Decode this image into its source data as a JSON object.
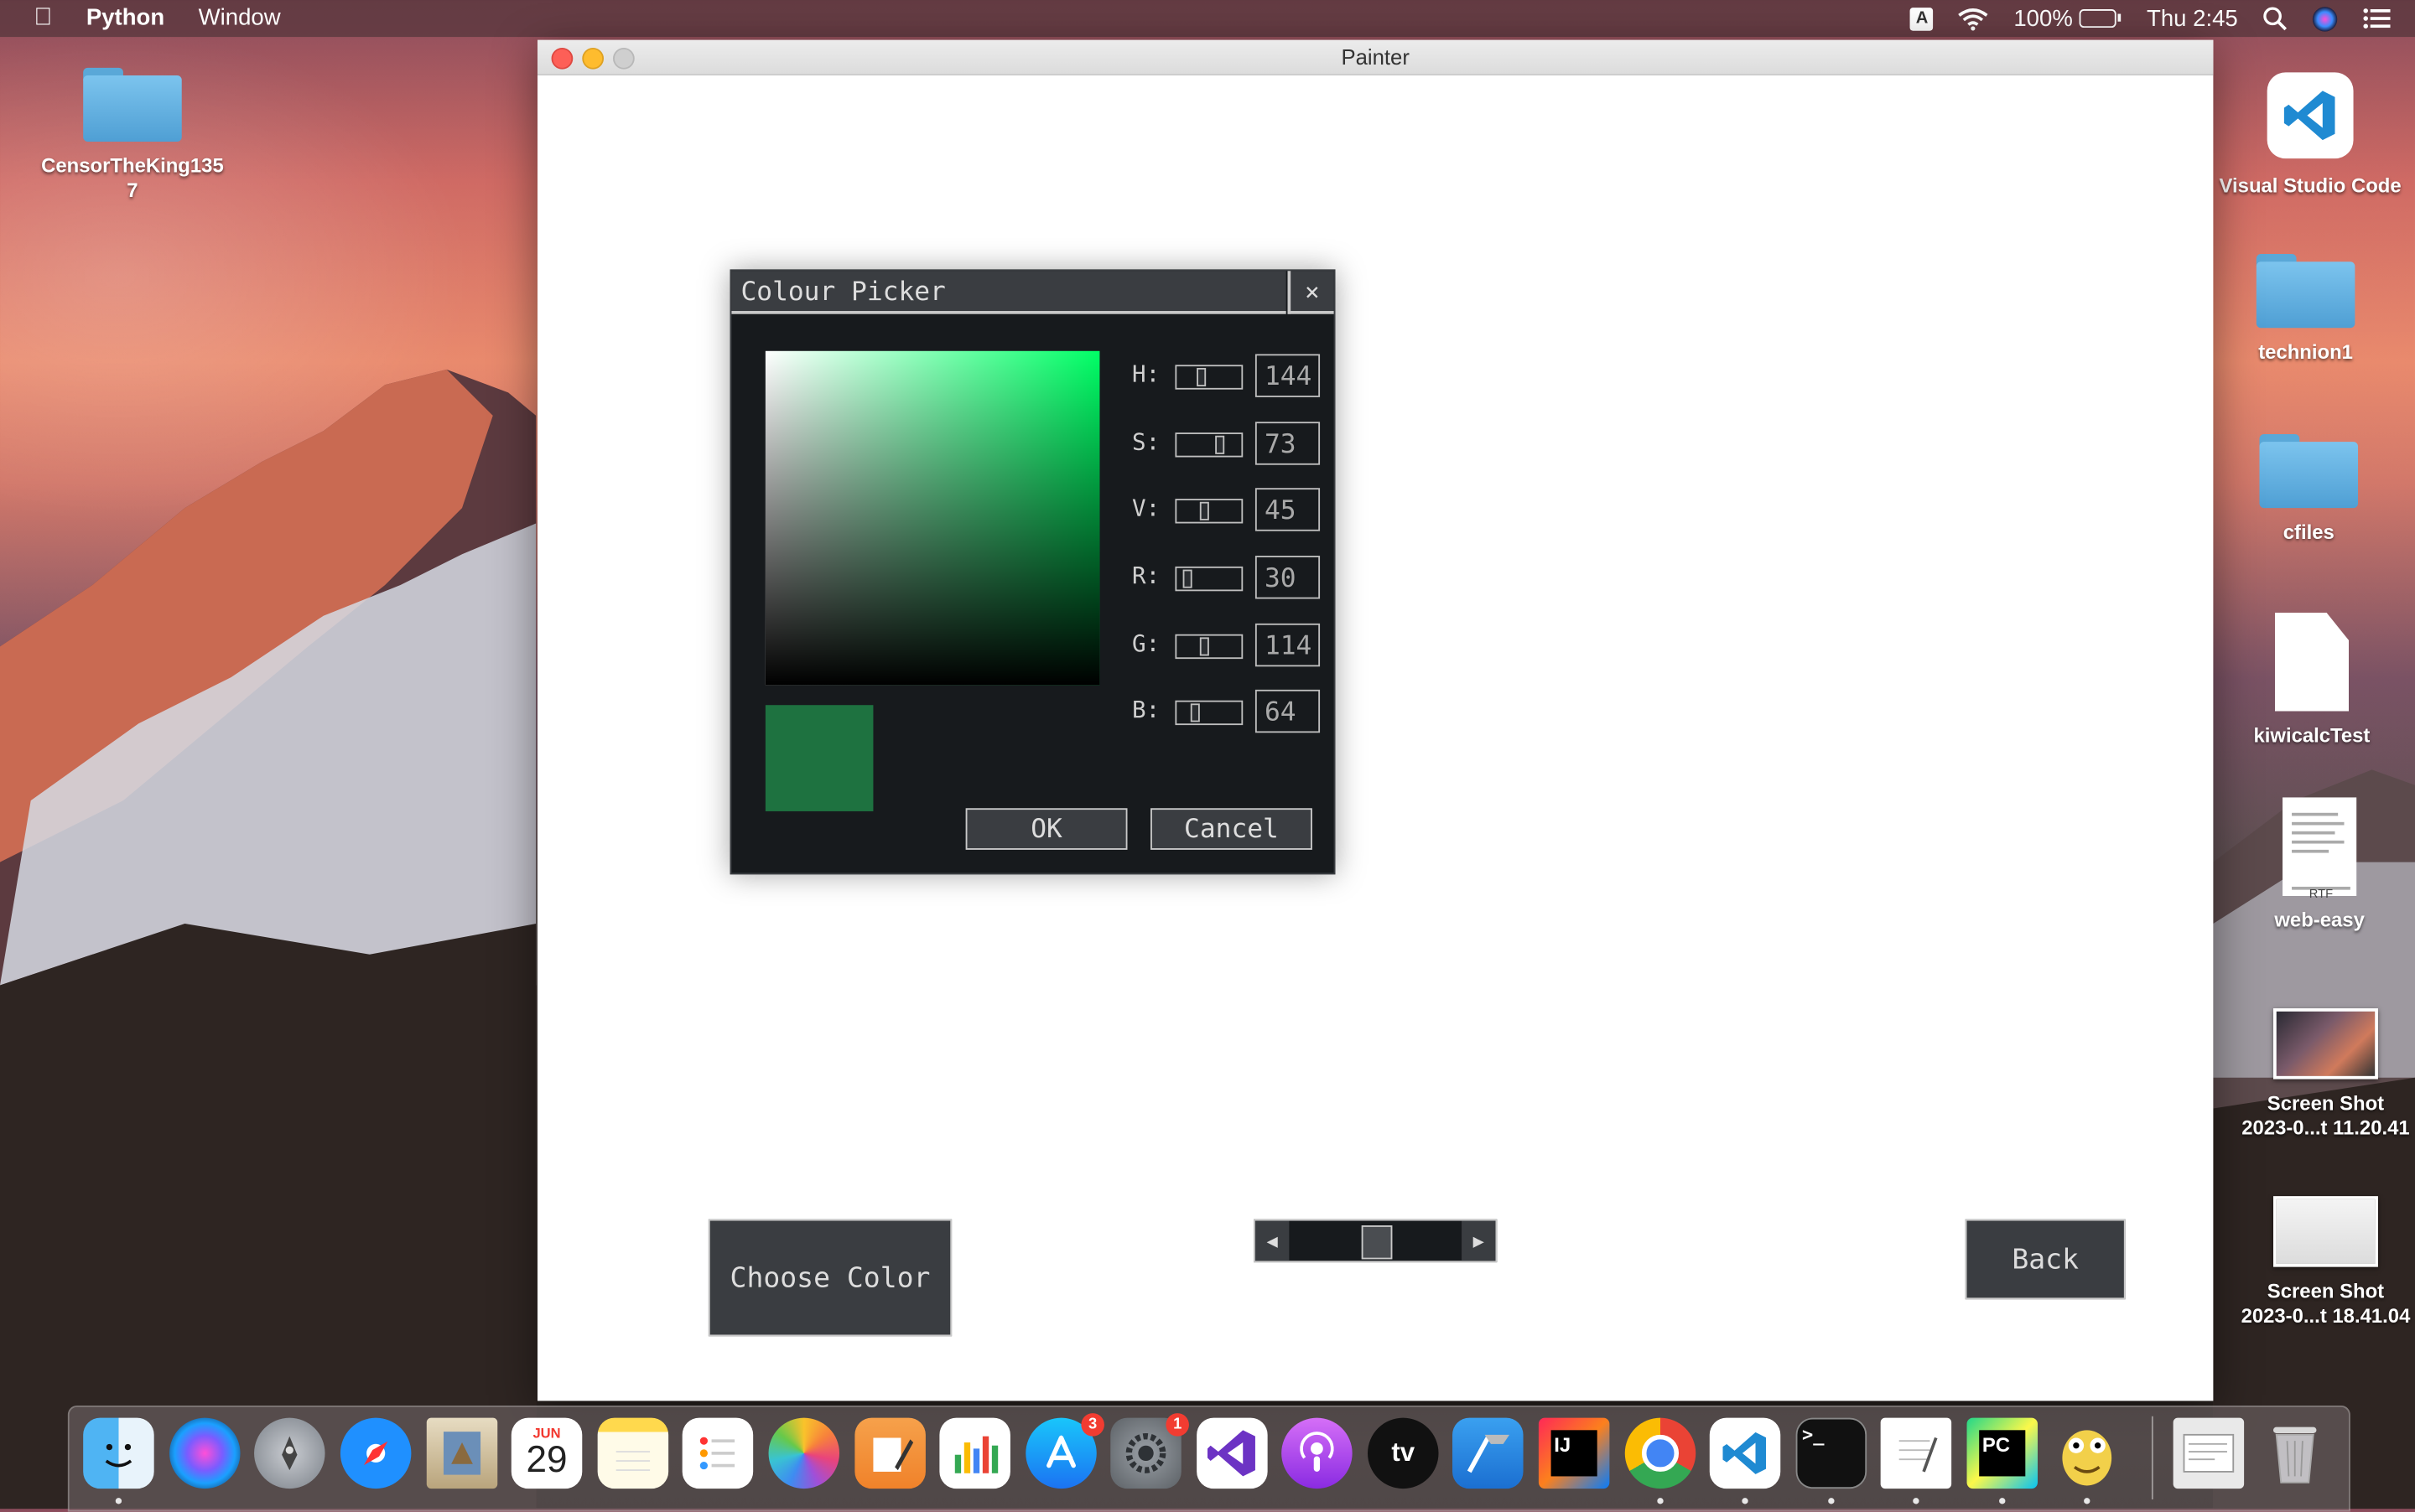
{
  "menubar": {
    "app_name": "Python",
    "menus": [
      "Window"
    ],
    "input_source": "A",
    "battery_text": "100%",
    "clock": "Thu 2:45"
  },
  "desktop": {
    "left_icons": [
      {
        "label": "CensorTheKing135\n7",
        "kind": "folder"
      }
    ],
    "right_icons": [
      {
        "label": "Visual Studio Code",
        "kind": "vscode-app"
      },
      {
        "label": "technion1",
        "kind": "folder"
      },
      {
        "label": "cfiles",
        "kind": "folder"
      },
      {
        "label": "kiwicalcTest",
        "kind": "document"
      },
      {
        "label": "web-easy",
        "kind": "rtf-document"
      },
      {
        "label": "Screen Shot\n2023-0...t 11.20.41",
        "kind": "screenshot"
      },
      {
        "label": "Screen Shot\n2023-0...t 18.41.04",
        "kind": "screenshot"
      }
    ]
  },
  "window": {
    "title": "Painter",
    "colour_picker": {
      "title": "Colour Picker",
      "close_glyph": "×",
      "preview_color": "#1e7240",
      "hue_color": "#00ff66",
      "channels": [
        {
          "label": "H:",
          "value": "144",
          "fraction": 0.39
        },
        {
          "label": "S:",
          "value": "73",
          "fraction": 0.73
        },
        {
          "label": "V:",
          "value": "45",
          "fraction": 0.45
        },
        {
          "label": "R:",
          "value": "30",
          "fraction": 0.12
        },
        {
          "label": "G:",
          "value": "114",
          "fraction": 0.45
        },
        {
          "label": "B:",
          "value": "64",
          "fraction": 0.25
        }
      ],
      "ok_label": "OK",
      "cancel_label": "Cancel"
    },
    "choose_color_label": "Choose Color",
    "back_label": "Back",
    "scrollbar": {
      "left_glyph": "◀",
      "right_glyph": "▶",
      "position": 0.5
    }
  },
  "dock": {
    "items": [
      {
        "name": "finder",
        "running": true
      },
      {
        "name": "siri",
        "running": false
      },
      {
        "name": "launchpad",
        "running": false
      },
      {
        "name": "safari",
        "running": false
      },
      {
        "name": "mail",
        "running": false
      },
      {
        "name": "calendar",
        "running": false,
        "month": "JUN",
        "day": "29"
      },
      {
        "name": "notes",
        "running": false
      },
      {
        "name": "reminders",
        "running": false
      },
      {
        "name": "photos",
        "running": false
      },
      {
        "name": "pages",
        "running": false
      },
      {
        "name": "numbers",
        "running": false
      },
      {
        "name": "app-store",
        "running": false,
        "badge": "3"
      },
      {
        "name": "system-preferences",
        "running": false,
        "badge": "1"
      },
      {
        "name": "visual-studio",
        "running": false
      },
      {
        "name": "podcasts",
        "running": false
      },
      {
        "name": "apple-tv",
        "running": false,
        "text": "tv"
      },
      {
        "name": "xcode",
        "running": false
      },
      {
        "name": "intellij",
        "running": false,
        "text": "IJ"
      },
      {
        "name": "chrome",
        "running": true
      },
      {
        "name": "vscode",
        "running": true
      },
      {
        "name": "terminal",
        "running": true,
        "text": ">_"
      },
      {
        "name": "textedit",
        "running": true
      },
      {
        "name": "pycharm",
        "running": true,
        "text": "PC"
      },
      {
        "name": "python-launcher",
        "running": true
      },
      {
        "name": "downloads-stack",
        "running": false
      },
      {
        "name": "trash",
        "running": false
      }
    ]
  }
}
